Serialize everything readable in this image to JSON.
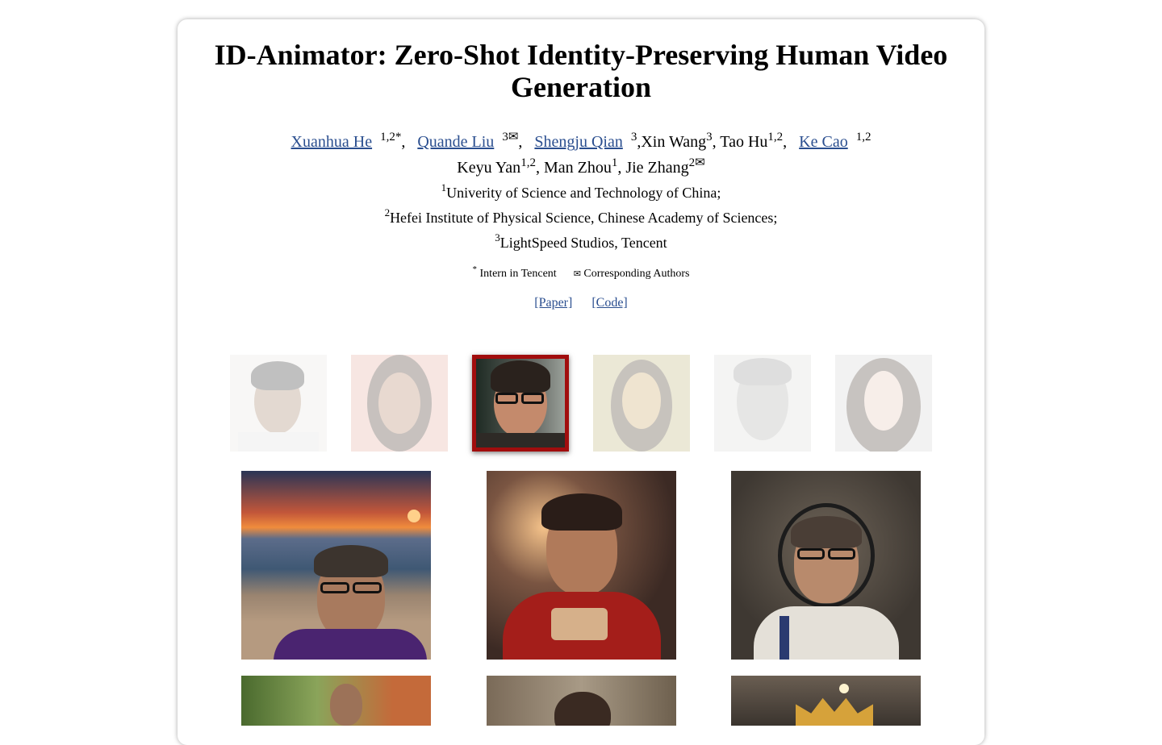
{
  "title": "ID-Animator: Zero-Shot Identity-Preserving Human Video Generation",
  "authors": {
    "a1_name": "Xuanhua He",
    "a1_sup": "1,2*",
    "a2_name": "Quande Liu",
    "a2_sup": "3✉",
    "a3_name": "Shengju Qian",
    "a3_sup": "3",
    "a4_name": "Xin Wang",
    "a4_sup": "3",
    "a5_name": "Tao Hu",
    "a5_sup": "1,2",
    "a6_name": "Ke Cao",
    "a6_sup": "1,2",
    "a7_name": "Keyu Yan",
    "a7_sup": "1,2",
    "a8_name": "Man Zhou",
    "a8_sup": "1",
    "a9_name": "Jie Zhang",
    "a9_sup": "2✉"
  },
  "affiliations": [
    {
      "sup": "1",
      "text": "Univerity of Science and Technology of China;"
    },
    {
      "sup": "2",
      "text": "Hefei Institute of Physical Science, Chinese Academy of Sciences;"
    },
    {
      "sup": "3",
      "text": "LightSpeed Studios, Tencent"
    }
  ],
  "notes": {
    "intern_sup": "*",
    "intern_text": "Intern in Tencent",
    "corr_symbol": "✉",
    "corr_text": "Corresponding Authors"
  },
  "links": {
    "paper": "[Paper]",
    "code": "[Code]"
  },
  "thumbnails": {
    "selected_index": 2,
    "items": [
      "face-thumbnail-1",
      "face-thumbnail-2",
      "face-thumbnail-3",
      "face-thumbnail-4",
      "face-thumbnail-5",
      "face-thumbnail-6"
    ]
  },
  "colors": {
    "link": "#2a4e8f",
    "selected_border": "#a10d0d"
  }
}
